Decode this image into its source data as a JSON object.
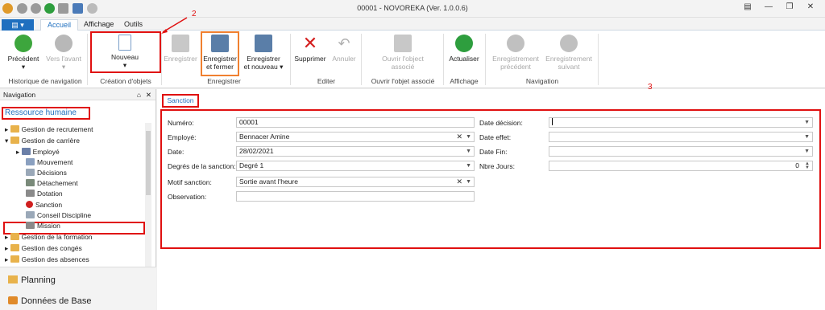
{
  "window": {
    "title": "00001 - NOVOREKA (Ver. 1.0.0.6)"
  },
  "tabs": {
    "file": "▤ ▾",
    "accueil": "Accueil",
    "affichage": "Affichage",
    "outils": "Outils"
  },
  "ribbon": {
    "precedent": "Précédent",
    "vers_avant": "Vers l'avant",
    "historique": "Historique de navigation",
    "nouveau": "Nouveau",
    "creation": "Création d'objets",
    "enregistrer": "Enregistrer",
    "enr_fermer_1": "Enregistrer",
    "enr_fermer_2": "et fermer",
    "enr_nouveau_1": "Enregistrer",
    "enr_nouveau_2": "et nouveau",
    "grp_enregistrer": "Enregistrer",
    "supprimer": "Supprimer",
    "annuler": "Annuler",
    "grp_editer": "Editer",
    "ouvrir_1": "Ouvrir l'object",
    "ouvrir_2": "associé",
    "grp_ouvrir": "Ouvrir l'objet associé",
    "actualiser": "Actualiser",
    "grp_affichage": "Affichage",
    "prec_1": "Enregistrement",
    "prec_2": "précédent",
    "suiv_1": "Enregistrement",
    "suiv_2": "suivant",
    "grp_navigation": "Navigation"
  },
  "nav": {
    "header": "Navigation",
    "root": "Ressource humaine",
    "items": [
      "Gestion de recrutement",
      "Gestion de carrière",
      "Employé",
      "Mouvement",
      "Décisions",
      "Détachement",
      "Dotation",
      "Sanction",
      "Conseil Discipline",
      "Mission",
      "Gestion de la formation",
      "Gestion des congés",
      "Gestion des absences"
    ],
    "planning": "Planning",
    "donnees": "Données de Base"
  },
  "annotations": {
    "a1": "1",
    "a2": "2",
    "a3": "3"
  },
  "form": {
    "tab": "Sanction",
    "numero_label": "Numéro:",
    "numero": "00001",
    "employe_label": "Employé:",
    "employe": "Bennacer Amine",
    "date_label": "Date:",
    "date": "28/02/2021",
    "degres_label": "Degrés de la sanction:",
    "degres": "Degré 1",
    "motif_label": "Motif sanction:",
    "motif": "Sortie avant l'heure",
    "obs_label": "Observation:",
    "obs": "",
    "date_decision_label": "Date décision:",
    "date_effet_label": "Date effet:",
    "date_fin_label": "Date Fin:",
    "nbre_jours_label": "Nbre Jours:",
    "nbre_jours": "0"
  }
}
